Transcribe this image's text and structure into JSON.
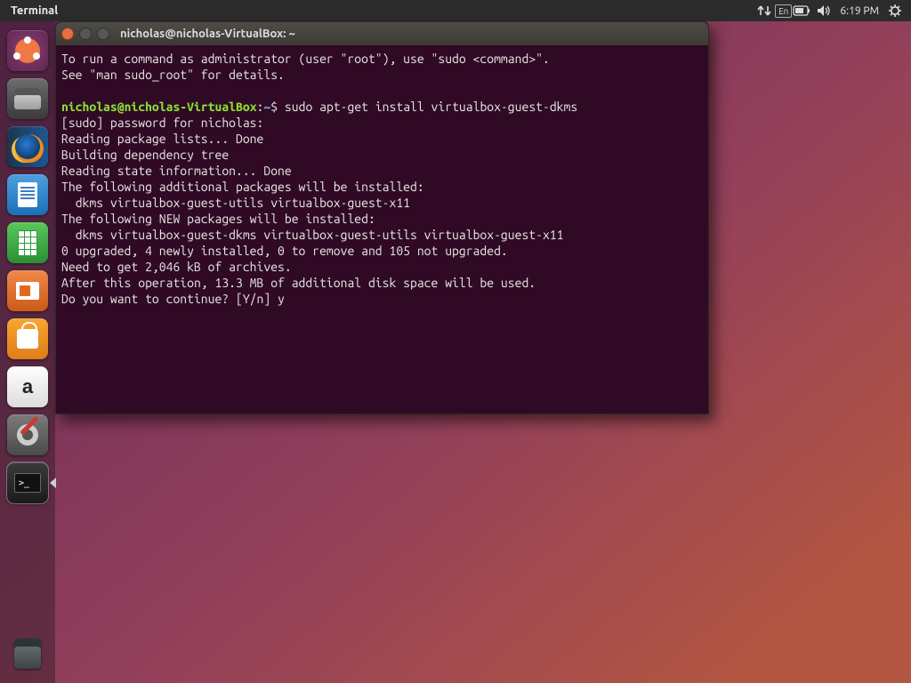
{
  "menubar": {
    "app_name": "Terminal",
    "time": "6:19 PM",
    "input_indicator": "En"
  },
  "launcher": {
    "items": [
      {
        "name": "ubuntu-dash"
      },
      {
        "name": "files"
      },
      {
        "name": "firefox"
      },
      {
        "name": "libreoffice-writer"
      },
      {
        "name": "libreoffice-calc"
      },
      {
        "name": "libreoffice-impress"
      },
      {
        "name": "ubuntu-software"
      },
      {
        "name": "amazon"
      },
      {
        "name": "system-settings"
      },
      {
        "name": "terminal"
      }
    ],
    "active_index": 9
  },
  "terminal": {
    "title": "nicholas@nicholas-VirtualBox: ~",
    "prompt": {
      "user": "nicholas",
      "host": "nicholas-VirtualBox",
      "path": "~",
      "symbol": "$"
    },
    "preamble": [
      "To run a command as administrator (user \"root\"), use \"sudo <command>\".",
      "See \"man sudo_root\" for details.",
      ""
    ],
    "command": "sudo apt-get install virtualbox-guest-dkms",
    "output": [
      "[sudo] password for nicholas:",
      "Reading package lists... Done",
      "Building dependency tree",
      "Reading state information... Done",
      "The following additional packages will be installed:",
      "  dkms virtualbox-guest-utils virtualbox-guest-x11",
      "The following NEW packages will be installed:",
      "  dkms virtualbox-guest-dkms virtualbox-guest-utils virtualbox-guest-x11",
      "0 upgraded, 4 newly installed, 0 to remove and 105 not upgraded.",
      "Need to get 2,046 kB of archives.",
      "After this operation, 13.3 MB of additional disk space will be used.",
      "Do you want to continue? [Y/n] y"
    ]
  },
  "amazon_glyph": "a"
}
